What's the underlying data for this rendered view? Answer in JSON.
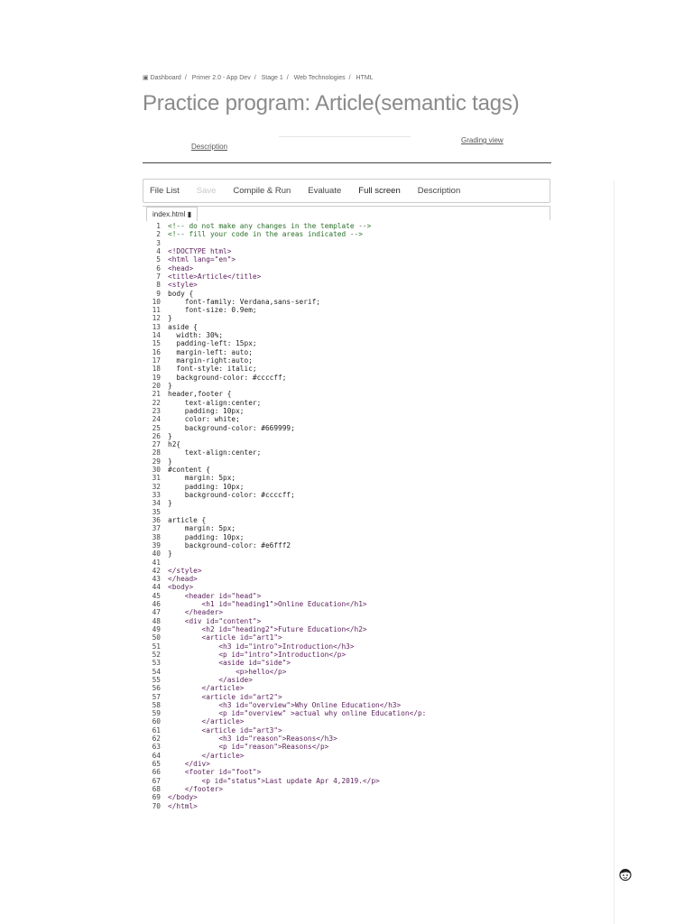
{
  "breadcrumb": [
    "Dashboard",
    "Primer 2.0 - App Dev",
    "Stage 1",
    "Web Technologies",
    "HTML"
  ],
  "page_title": "Practice program: Article(semantic tags)",
  "links": {
    "description": "Description",
    "grading_view": "Grading view"
  },
  "toolbar": {
    "file_list": "File List",
    "save": "Save",
    "compile_run": "Compile & Run",
    "evaluate": "Evaluate",
    "full_screen": "Full screen",
    "description": "Description"
  },
  "file_tab": "index.html",
  "code_lines": [
    "<!-- do not make any changes in the template -->",
    "<!-- fill your code in the areas indicated -->",
    "",
    "<!DOCTYPE html>",
    "<html lang=\"en\">",
    "<head>",
    "<title>Article</title>",
    "<style>",
    "body {",
    "    font-family: Verdana,sans-serif;",
    "    font-size: 0.9em;",
    "}",
    "aside {",
    "  width: 30%;",
    "  padding-left: 15px;",
    "  margin-left: auto;",
    "  margin-right:auto;",
    "  font-style: italic;",
    "  background-color: #ccccff;",
    "}",
    "header,footer {",
    "    text-align:center;",
    "    padding: 10px;",
    "    color: white;",
    "    background-color: #669999;",
    "}",
    "h2{",
    "    text-align:center;",
    "}",
    "#content {",
    "    margin: 5px;",
    "    padding: 10px;",
    "    background-color: #ccccff;",
    "}",
    "",
    "article {",
    "    margin: 5px;",
    "    padding: 10px;",
    "    background-color: #e6fff2",
    "}",
    "",
    "</style>",
    "</head>",
    "<body>",
    "    <header id=\"head\">",
    "        <h1 id=\"heading1\">Online Education</h1>",
    "    </header>",
    "    <div id=\"content\">",
    "        <h2 id=\"heading2\">Future Education</h2>",
    "        <article id=\"art1\">",
    "            <h3 id=\"intro\">Introduction</h3>",
    "            <p id=\"intro\">Introduction</p>",
    "            <aside id=\"side\">",
    "                <p>hello</p>",
    "            </aside>",
    "        </article>",
    "        <article id=\"art2\">",
    "            <h3 id=\"overview\">Why Online Education</h3>",
    "            <p id=\"overview\" >actual why online Education</p:",
    "        </article>",
    "        <article id=\"art3\">",
    "            <h3 id=\"reason\">Reasons</h3>",
    "            <p id=\"reason\">Reasons</p>",
    "        </article>",
    "    </div>",
    "    <footer id=\"foot\">",
    "        <p id=\"status\">Last update Apr 4,2019.</p>",
    "    </footer>",
    "</body>",
    "</html>"
  ]
}
